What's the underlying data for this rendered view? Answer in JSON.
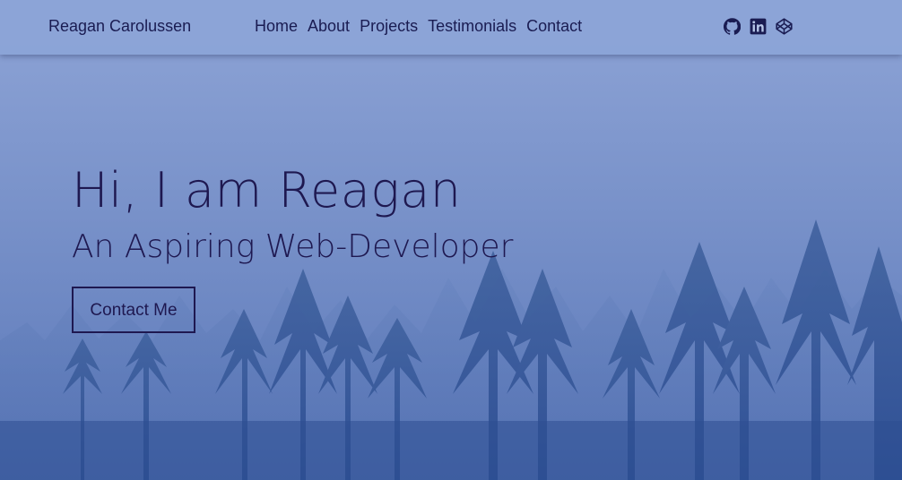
{
  "nav": {
    "brand": "Reagan Carolussen",
    "links": [
      "Home",
      "About",
      "Projects",
      "Testimonials",
      "Contact"
    ],
    "social_icons": [
      "github-icon",
      "linkedin-icon",
      "codepen-icon"
    ]
  },
  "hero": {
    "title": "Hi, I am Reagan",
    "subtitle": "An Aspiring Web-Developer",
    "cta_label": "Contact Me"
  },
  "colors": {
    "text_dark": "#1e1850",
    "nav_bg": "#8ca5d7",
    "forest_overlay": "#3f5fa8"
  }
}
